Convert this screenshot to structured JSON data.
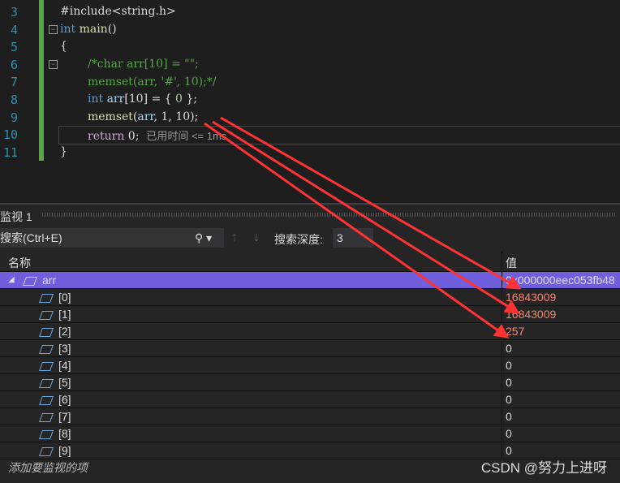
{
  "editor": {
    "line_numbers": [
      "3",
      "4",
      "5",
      "6",
      "7",
      "8",
      "9",
      "10",
      "11"
    ],
    "lines": {
      "l3": "#include<string.h>",
      "l4a": "int",
      "l4b": "main",
      "l4c": "()",
      "l5": "{",
      "l6": "/*char arr[10] = \"\";",
      "l7": "memset(arr, '#', 10);*/",
      "l8a": "int",
      "l8b": "arr",
      "l8c": "[10] = { ",
      "l8d": "0",
      "l8e": " };",
      "l9a": "memset",
      "l9b": "(",
      "l9c": "arr",
      "l9d": ", 1, 10);",
      "l10a": "return",
      "l10b": " 0;",
      "l11": "}"
    },
    "hint": "已用时间 <= 1ms"
  },
  "watch": {
    "title": "监视 1",
    "search_placeholder": "搜索(Ctrl+E)",
    "depth_label": "搜索深度:",
    "depth_value": "3",
    "col_name": "名称",
    "col_value": "值",
    "root": {
      "name": "arr",
      "value": "0x000000eec053fb48"
    },
    "items": [
      {
        "name": "[0]",
        "value": "16843009"
      },
      {
        "name": "[1]",
        "value": "16843009"
      },
      {
        "name": "[2]",
        "value": "257"
      },
      {
        "name": "[3]",
        "value": "0"
      },
      {
        "name": "[4]",
        "value": "0"
      },
      {
        "name": "[5]",
        "value": "0"
      },
      {
        "name": "[6]",
        "value": "0"
      },
      {
        "name": "[7]",
        "value": "0"
      },
      {
        "name": "[8]",
        "value": "0"
      },
      {
        "name": "[9]",
        "value": "0"
      }
    ],
    "add_item": "添加要监视的项"
  },
  "watermark": "CSDN @努力上进呀",
  "colors": {
    "selection": "#6f5fdd",
    "changed": "#f48771",
    "annotation": "#ff3333"
  }
}
